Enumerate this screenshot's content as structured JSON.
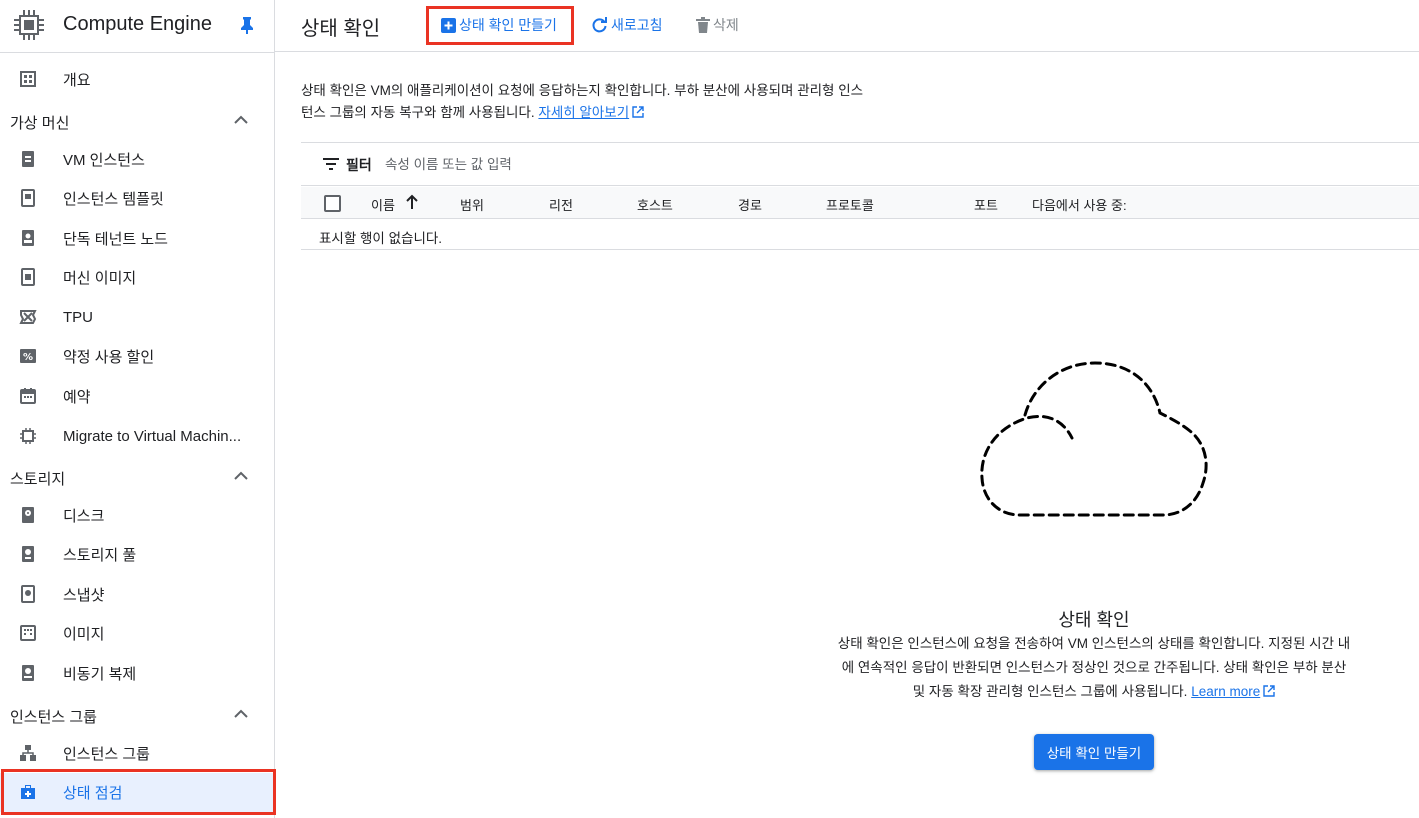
{
  "app": {
    "product_title": "Compute Engine"
  },
  "sidebar": {
    "overview": "개요",
    "sections": [
      {
        "label": "가상 머신",
        "items": [
          "VM 인스턴스",
          "인스턴스 템플릿",
          "단독 테넌트 노드",
          "머신 이미지",
          "TPU",
          "약정 사용 할인",
          "예약",
          "Migrate to Virtual Machin..."
        ]
      },
      {
        "label": "스토리지",
        "items": [
          "디스크",
          "스토리지 풀",
          "스냅샷",
          "이미지",
          "비동기 복제"
        ]
      },
      {
        "label": "인스턴스 그룹",
        "items": [
          "인스턴스 그룹",
          "상태 점검"
        ]
      }
    ],
    "active_item": "상태 점검"
  },
  "toolbar": {
    "page_title": "상태 확인",
    "create_label": "상태 확인 만들기",
    "refresh_label": "새로고침",
    "delete_label": "삭제"
  },
  "description": {
    "text": "상태 확인은 VM의 애플리케이션이 요청에 응답하는지 확인합니다. 부하 분산에 사용되며 관리형 인스턴스 그룹의 자동 복구와 함께 사용됩니다.",
    "link": "자세히 알아보기"
  },
  "filter": {
    "label": "필터",
    "placeholder": "속성 이름 또는 값 입력"
  },
  "table": {
    "columns": [
      "이름",
      "범위",
      "리전",
      "호스트",
      "경로",
      "프로토콜",
      "포트",
      "다음에서 사용 중:"
    ],
    "sort_column": "이름",
    "sort_direction": "ascending",
    "empty_message": "표시할 행이 없습니다."
  },
  "empty_state": {
    "title": "상태 확인",
    "text": "상태 확인은 인스턴스에 요청을 전송하여 VM 인스턴스의 상태를 확인합니다. 지정된 시간 내에 연속적인 응답이 반환되면 인스턴스가 정상인 것으로 간주됩니다. 상태 확인은 부하 분산 및 자동 확장 관리형 인스턴스 그룹에 사용됩니다.",
    "link": "Learn more",
    "button_label": "상태 확인 만들기"
  },
  "colors": {
    "accent": "#1a73e8",
    "highlight": "#ea3323",
    "active_bg": "#e8f0fe"
  }
}
